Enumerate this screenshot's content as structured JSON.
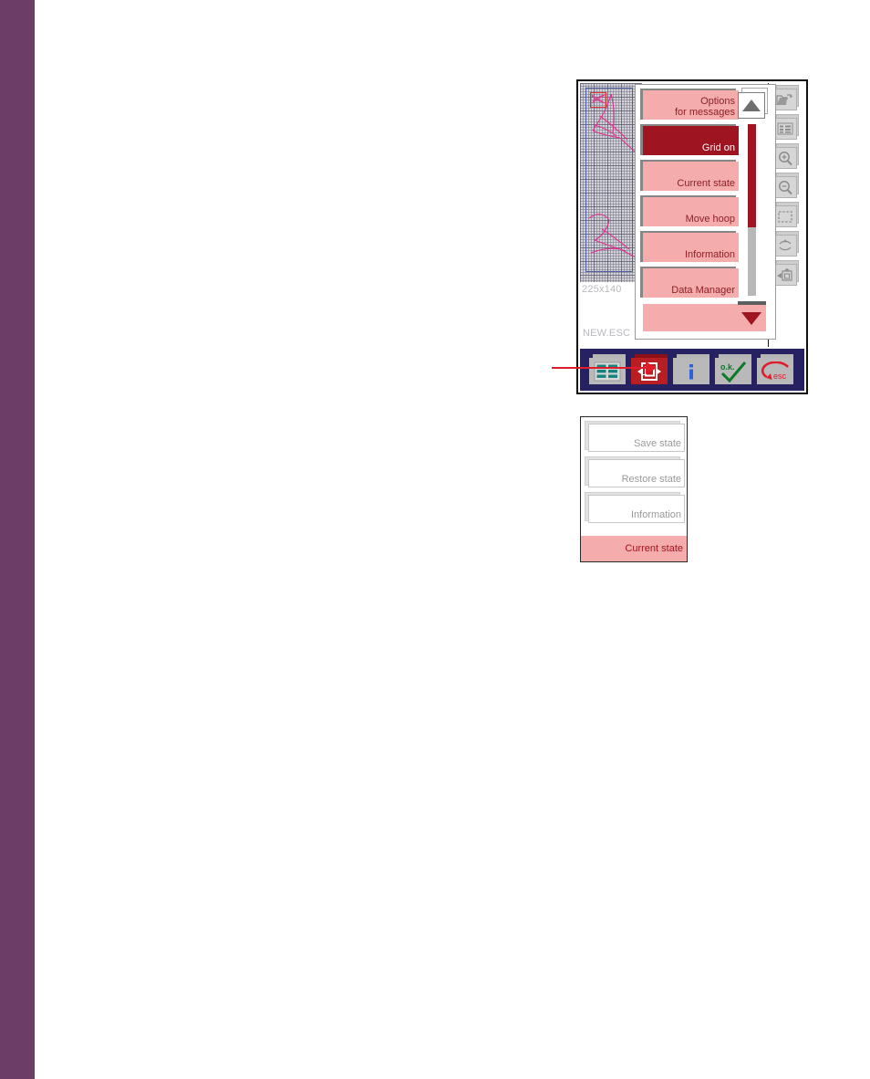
{
  "page": {
    "spine_color": "#6B3D67",
    "background": "#ffffff"
  },
  "device": {
    "screen_border_color": "#111111",
    "preview": {
      "dimension_label": "225x140",
      "file_label": "NEW.ESC",
      "selection_box_name": "selected-stitch-block",
      "grid_visible": true,
      "design_color": "#e0318f",
      "hoop_outline_color": "#4f5e9e"
    },
    "menu": {
      "items": [
        {
          "label": "Options\nfor messages",
          "selected": false,
          "blank": false
        },
        {
          "label": "Grid on",
          "selected": true,
          "blank": false
        },
        {
          "label": "Current state",
          "selected": false,
          "blank": false
        },
        {
          "label": "Move hoop",
          "selected": false,
          "blank": false
        },
        {
          "label": "Information",
          "selected": false,
          "blank": false
        },
        {
          "label": "Data Manager",
          "selected": false,
          "blank": false
        },
        {
          "label": "",
          "selected": false,
          "blank": true
        }
      ],
      "scrollbar": {
        "up_arrow": "triangle-up",
        "down_arrow": "triangle-down",
        "thumb_color": "#9e1420",
        "track_color": "#b8b8b8",
        "thumb_fraction": 60
      },
      "colors": {
        "item_face": "#f4acac",
        "item_text": "#8f1f28",
        "item_selected_face": "#9e1420",
        "item_selected_text": "#ffffff"
      }
    },
    "rail": {
      "buttons": [
        {
          "icon": "open-folder-icon",
          "label": "Open design"
        },
        {
          "icon": "list-view-icon",
          "label": "List view"
        },
        {
          "icon": "zoom-in-icon",
          "label": "Zoom in"
        },
        {
          "icon": "zoom-out-icon",
          "label": "Zoom out"
        },
        {
          "icon": "selection-frame-icon",
          "label": "Select area"
        },
        {
          "icon": "flip-vertical-icon",
          "label": "Mirror / flip"
        },
        {
          "icon": "send-to-machine-icon",
          "label": "Transfer design"
        }
      ]
    },
    "toolbar": {
      "background": "#262262",
      "buttons": [
        {
          "icon": "grid-table-icon",
          "label": "Table view",
          "active": false
        },
        {
          "icon": "hoop-icon",
          "label": "Hoop settings",
          "active": true
        },
        {
          "icon": "info-icon",
          "label": "Information",
          "active": false
        },
        {
          "icon": "ok-check-icon",
          "label": "o.k.",
          "active": false
        },
        {
          "icon": "esc-back-icon",
          "label": "esc",
          "active": false
        }
      ]
    }
  },
  "callout": {
    "color": "#e01b2a",
    "points_to": "hoop-settings-button"
  },
  "state_panel": {
    "items": [
      {
        "label": "Save state"
      },
      {
        "label": "Restore state"
      },
      {
        "label": "Information"
      }
    ],
    "current": {
      "label": "Current state",
      "face_color": "#f4acac",
      "text_color": "#9e1420"
    }
  }
}
